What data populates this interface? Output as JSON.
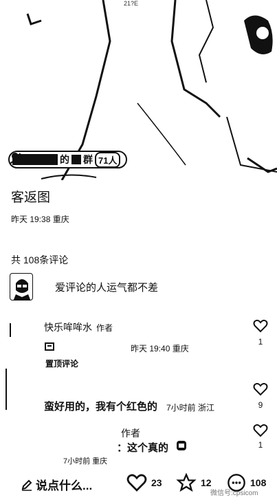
{
  "photo": {
    "top_text": "21?E"
  },
  "group_pill": {
    "of_text": "的",
    "group_text": "群",
    "count": "71人"
  },
  "post": {
    "title": "客返图",
    "meta": "昨天 19:38 重庆"
  },
  "comments_header": {
    "count_label": "共 108条评论"
  },
  "prompt": {
    "text": "爱评论的人运气都不差"
  },
  "comments": [
    {
      "name": "快乐哞哞水",
      "tag": "作者",
      "time": "昨天 19:40 重庆",
      "pin": "置顶评论",
      "likes": "1"
    },
    {
      "body": "蛮好用的，我有个红色的",
      "time": "7小时前 浙江",
      "likes": "9"
    },
    {
      "tag": "作者",
      "body": "：这个真的",
      "likes": "1",
      "time": "7小时前 重庆"
    }
  ],
  "bottom_bar": {
    "say_label": "说点什么...",
    "likes": "23",
    "favorites": "12",
    "comments": "108"
  },
  "watermark": "微信号:cpsicom"
}
